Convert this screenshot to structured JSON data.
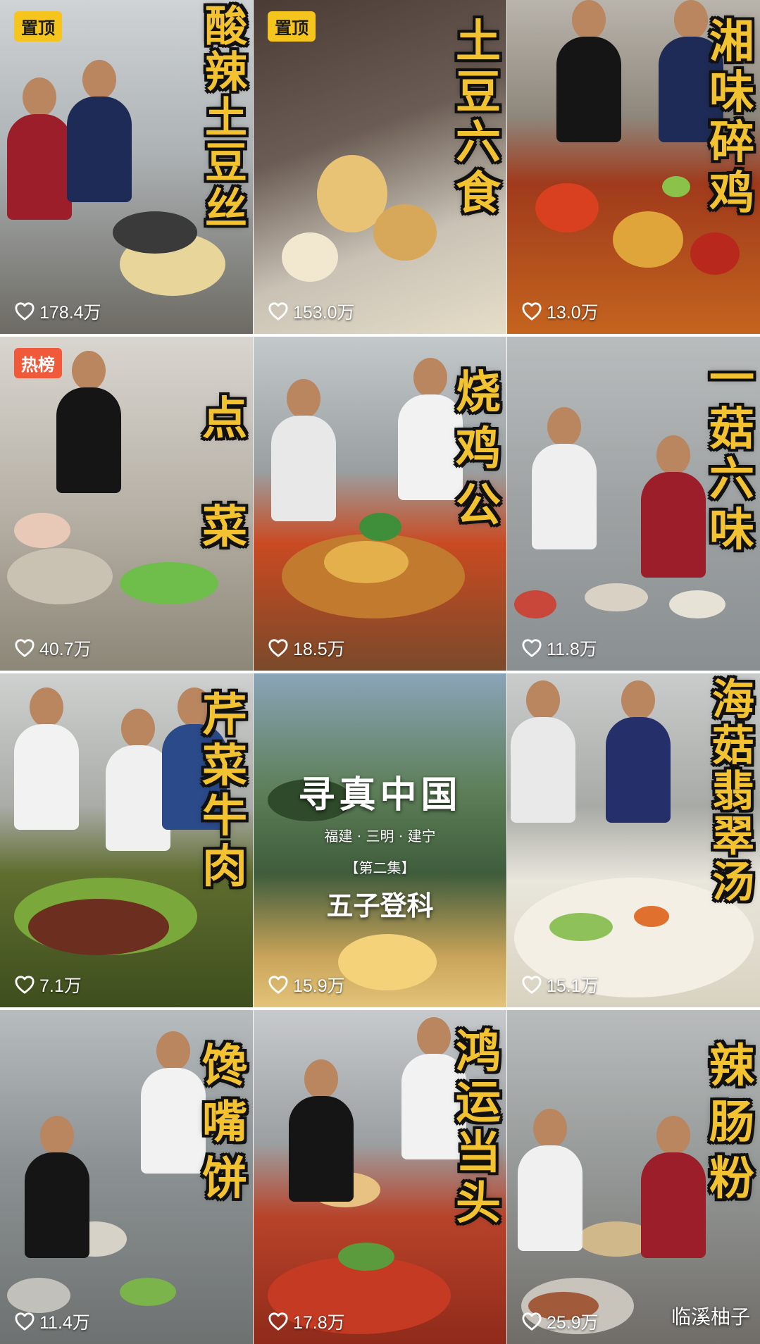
{
  "colors": {
    "title_fill": "#f2c230",
    "title_stroke": "#111111",
    "pinned_badge_bg": "#f5c51e",
    "hot_badge_bg": "#f05a3a",
    "like_text": "#ffffff"
  },
  "icons": {
    "like": "heart-outline-icon"
  },
  "videos": [
    {
      "title": "酸辣土豆丝",
      "likes": "178.4万",
      "badge": "置顶",
      "badge_type": "pinned"
    },
    {
      "title": "土豆六食",
      "likes": "153.0万",
      "badge": "置顶",
      "badge_type": "pinned"
    },
    {
      "title": "湘味碎鸡",
      "likes": "13.0万",
      "badge": "",
      "badge_type": ""
    },
    {
      "title": "点菜",
      "likes": "40.7万",
      "badge": "热榜",
      "badge_type": "hot"
    },
    {
      "title": "烧鸡公",
      "likes": "18.5万",
      "badge": "",
      "badge_type": ""
    },
    {
      "title": "一菇六味",
      "likes": "11.8万",
      "badge": "",
      "badge_type": ""
    },
    {
      "title": "芹菜牛肉",
      "likes": "7.1万",
      "badge": "",
      "badge_type": ""
    },
    {
      "title": "",
      "likes": "15.9万",
      "badge": "",
      "badge_type": "",
      "promo": {
        "title": "寻真中国",
        "subtitle": "福建 · 三明 · 建宁",
        "episode": "【第二集】",
        "name": "五子登科"
      }
    },
    {
      "title": "海菇翡翠汤",
      "likes": "15.1万",
      "badge": "",
      "badge_type": ""
    },
    {
      "title": "馋嘴饼",
      "likes": "11.4万",
      "badge": "",
      "badge_type": ""
    },
    {
      "title": "鸿运当头",
      "likes": "17.8万",
      "badge": "",
      "badge_type": ""
    },
    {
      "title": "辣肠粉",
      "likes": "25.9万",
      "badge": "",
      "badge_type": ""
    }
  ],
  "watermark": "临溪柚子"
}
